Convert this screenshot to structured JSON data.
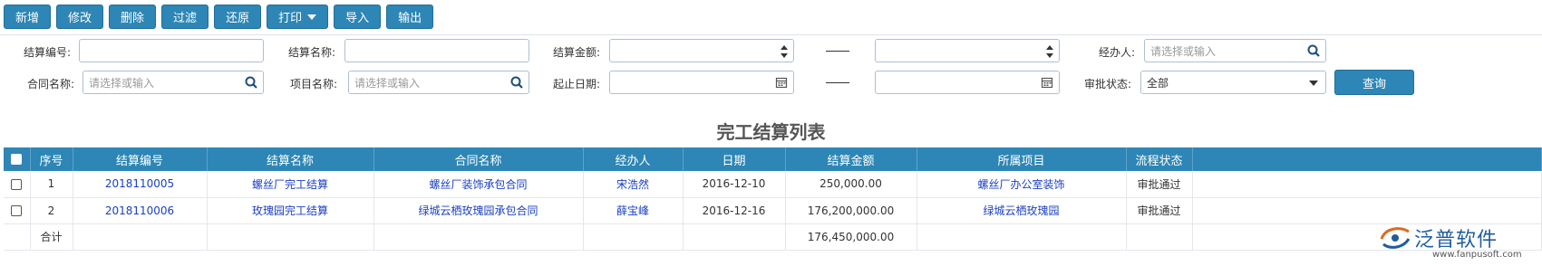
{
  "toolbar": {
    "buttons": [
      "新增",
      "修改",
      "删除",
      "过滤",
      "还原",
      "打印",
      "导入",
      "输出"
    ]
  },
  "filters": {
    "settle_no_label": "结算编号:",
    "settle_name_label": "结算名称:",
    "settle_amount_label": "结算金额:",
    "handler_label": "经办人:",
    "handler_placeholder": "请选择或输入",
    "contract_label": "合同名称:",
    "contract_placeholder": "请选择或输入",
    "project_label": "项目名称:",
    "project_placeholder": "请选择或输入",
    "date_range_label": "起止日期:",
    "approval_label": "审批状态:",
    "approval_value": "全部",
    "query_button": "查询"
  },
  "title": "完工结算列表",
  "table": {
    "headers": [
      "序号",
      "结算编号",
      "结算名称",
      "合同名称",
      "经办人",
      "日期",
      "结算金额",
      "所属项目",
      "流程状态"
    ],
    "rows": [
      {
        "no": "1",
        "code": "2018110005",
        "name": "螺丝厂完工结算",
        "contract": "螺丝厂装饰承包合同",
        "handler": "宋浩然",
        "date": "2016-12-10",
        "amount": "250,000.00",
        "project": "螺丝厂办公室装饰",
        "status": "审批通过"
      },
      {
        "no": "2",
        "code": "2018110006",
        "name": "玫瑰园完工结算",
        "contract": "绿城云栖玫瑰园承包合同",
        "handler": "薛宝峰",
        "date": "2016-12-16",
        "amount": "176,200,000.00",
        "project": "绿城云栖玫瑰园",
        "status": "审批通过"
      }
    ],
    "total_label": "合计",
    "total_amount": "176,450,000.00"
  },
  "logo": {
    "name": "泛普软件",
    "url": "www.fanpusoft.com"
  },
  "colors": {
    "accent": "#2d86b5",
    "link": "#1a3fc6"
  }
}
